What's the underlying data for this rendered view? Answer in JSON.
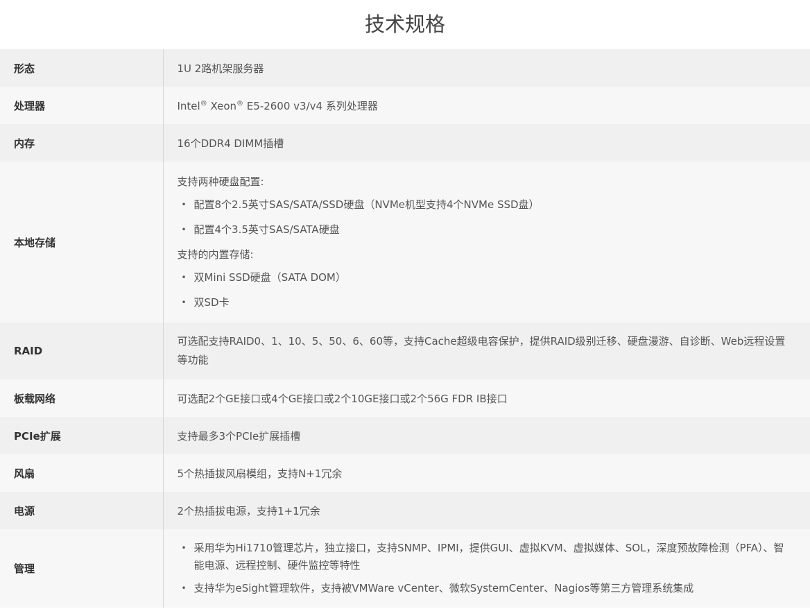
{
  "title": "技术规格",
  "rows": {
    "form": {
      "key": "形态",
      "value": "1U 2路机架服务器"
    },
    "cpu": {
      "key": "处理器",
      "brand1": "Intel",
      "reg1": "®",
      "brand2": " Xeon",
      "reg2": "®",
      "rest": " E5-2600 v3/v4 系列处理器"
    },
    "memory": {
      "key": "内存",
      "value": "16个DDR4 DIMM插槽"
    },
    "storage": {
      "key": "本地存储",
      "intro1": "支持两种硬盘配置:",
      "items1": [
        "配置8个2.5英寸SAS/SATA/SSD硬盘（NVMe机型支持4个NVMe SSD盘）",
        "配置4个3.5英寸SAS/SATA硬盘"
      ],
      "intro2": "支持的内置存储:",
      "items2": [
        "双Mini SSD硬盘（SATA DOM）",
        "双SD卡"
      ]
    },
    "raid": {
      "key": "RAID",
      "value": "可选配支持RAID0、1、10、5、50、6、60等，支持Cache超级电容保护，提供RAID级别迁移、硬盘漫游、自诊断、Web远程设置等功能"
    },
    "network": {
      "key": "板载网络",
      "value": "可选配2个GE接口或4个GE接口或2个10GE接口或2个56G FDR IB接口"
    },
    "pcie": {
      "key": "PCIe扩展",
      "value": "支持最多3个PCIe扩展插槽"
    },
    "fan": {
      "key": "风扇",
      "value": "5个热插拔风扇模组，支持N+1冗余"
    },
    "power": {
      "key": "电源",
      "value": "2个热插拔电源，支持1+1冗余"
    },
    "mgmt": {
      "key": "管理",
      "items": [
        "采用华为Hi1710管理芯片，独立接口，支持SNMP、IPMI，提供GUI、虚拟KVM、虚拟媒体、SOL，深度预故障检测（PFA）、智能电源、远程控制、硬件监控等特性",
        "支持华为eSight管理软件，支持被VMWare vCenter、微软SystemCenter、Nagios等第三方管理系统集成"
      ]
    }
  },
  "bullet_char": "•"
}
